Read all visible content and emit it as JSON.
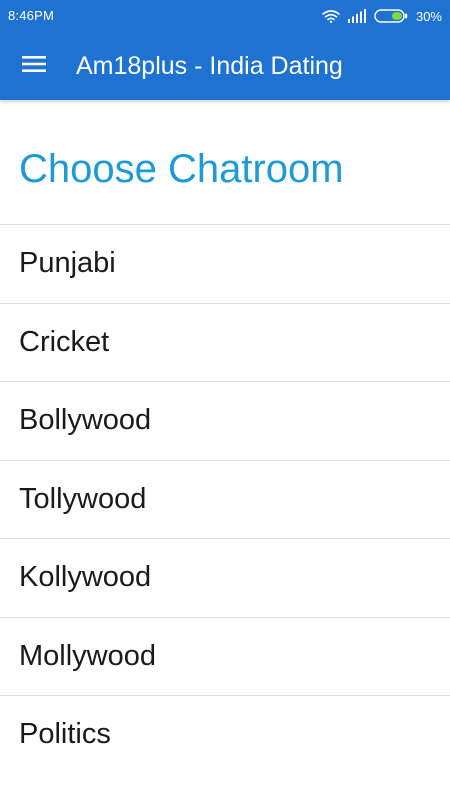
{
  "status_bar": {
    "time": "8:46PM",
    "battery_percent": "30%",
    "icons": [
      "wifi-icon",
      "signal-icon",
      "battery-icon"
    ]
  },
  "app_bar": {
    "title": "Am18plus - India Dating",
    "menu_icon": "menu-icon"
  },
  "main": {
    "heading": "Choose Chatroom",
    "rooms": [
      {
        "label": "Punjabi"
      },
      {
        "label": "Cricket"
      },
      {
        "label": "Bollywood"
      },
      {
        "label": "Tollywood"
      },
      {
        "label": "Kollywood"
      },
      {
        "label": "Mollywood"
      },
      {
        "label": "Politics"
      }
    ]
  },
  "colors": {
    "primary": "#1e73d2",
    "heading": "#1e9bd7",
    "text": "#1a1a1a",
    "divider": "#dcdcdc"
  }
}
